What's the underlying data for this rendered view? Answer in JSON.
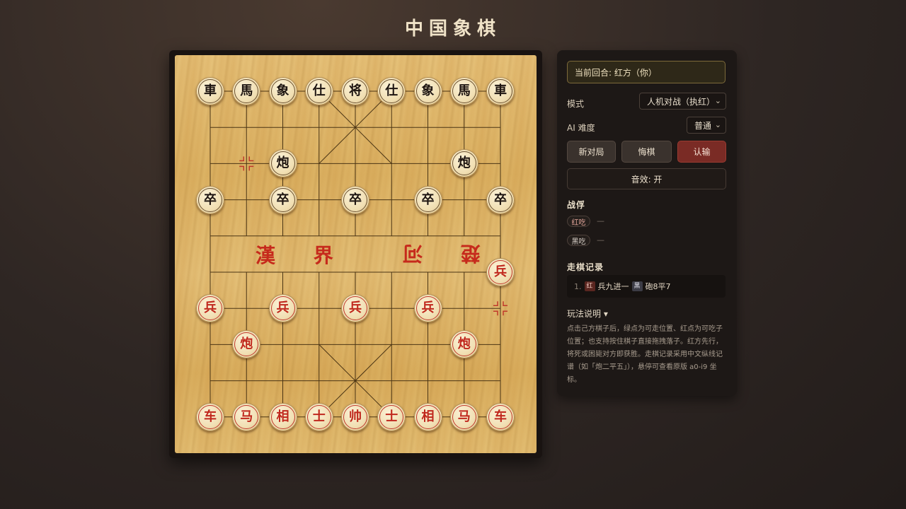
{
  "page_title": "中国象棋",
  "board": {
    "river_left": "漢 界",
    "river_right": "楚 河",
    "pieces": [
      {
        "c": "車",
        "side": "black",
        "f": 0,
        "r": 0
      },
      {
        "c": "馬",
        "side": "black",
        "f": 1,
        "r": 0
      },
      {
        "c": "象",
        "side": "black",
        "f": 2,
        "r": 0
      },
      {
        "c": "仕",
        "side": "black",
        "f": 3,
        "r": 0
      },
      {
        "c": "将",
        "side": "black",
        "f": 4,
        "r": 0
      },
      {
        "c": "仕",
        "side": "black",
        "f": 5,
        "r": 0
      },
      {
        "c": "象",
        "side": "black",
        "f": 6,
        "r": 0
      },
      {
        "c": "馬",
        "side": "black",
        "f": 7,
        "r": 0
      },
      {
        "c": "車",
        "side": "black",
        "f": 8,
        "r": 0
      },
      {
        "c": "炮",
        "side": "black",
        "f": 2,
        "r": 2
      },
      {
        "c": "炮",
        "side": "black",
        "f": 7,
        "r": 2
      },
      {
        "c": "卒",
        "side": "black",
        "f": 0,
        "r": 3
      },
      {
        "c": "卒",
        "side": "black",
        "f": 2,
        "r": 3
      },
      {
        "c": "卒",
        "side": "black",
        "f": 4,
        "r": 3
      },
      {
        "c": "卒",
        "side": "black",
        "f": 6,
        "r": 3
      },
      {
        "c": "卒",
        "side": "black",
        "f": 8,
        "r": 3
      },
      {
        "c": "兵",
        "side": "red",
        "f": 8,
        "r": 5
      },
      {
        "c": "兵",
        "side": "red",
        "f": 0,
        "r": 6
      },
      {
        "c": "兵",
        "side": "red",
        "f": 2,
        "r": 6
      },
      {
        "c": "兵",
        "side": "red",
        "f": 4,
        "r": 6
      },
      {
        "c": "兵",
        "side": "red",
        "f": 6,
        "r": 6
      },
      {
        "c": "炮",
        "side": "red",
        "f": 1,
        "r": 7
      },
      {
        "c": "炮",
        "side": "red",
        "f": 7,
        "r": 7
      },
      {
        "c": "车",
        "side": "red",
        "f": 0,
        "r": 9
      },
      {
        "c": "马",
        "side": "red",
        "f": 1,
        "r": 9
      },
      {
        "c": "相",
        "side": "red",
        "f": 2,
        "r": 9
      },
      {
        "c": "士",
        "side": "red",
        "f": 3,
        "r": 9
      },
      {
        "c": "帅",
        "side": "red",
        "f": 4,
        "r": 9
      },
      {
        "c": "士",
        "side": "red",
        "f": 5,
        "r": 9
      },
      {
        "c": "相",
        "side": "red",
        "f": 6,
        "r": 9
      },
      {
        "c": "马",
        "side": "red",
        "f": 7,
        "r": 9
      },
      {
        "c": "车",
        "side": "red",
        "f": 8,
        "r": 9
      }
    ],
    "last_move_markers": [
      {
        "f": 1,
        "r": 2,
        "color": "#c0392b"
      },
      {
        "f": 8,
        "r": 6,
        "color": "#c0392b"
      }
    ]
  },
  "panel": {
    "turn_text": "当前回合: 红方（你）",
    "mode_label": "模式",
    "mode_value": "人机对战（执红）",
    "difficulty_label": "AI 难度",
    "difficulty_value": "普通",
    "new_game": "新对局",
    "undo": "悔棋",
    "resign": "认输",
    "sound": "音效: 开",
    "captures_title": "战俘",
    "red_captured_label": "红吃",
    "red_captured_value": "—",
    "black_captured_label": "黑吃",
    "black_captured_value": "—",
    "record_title": "走棋记录",
    "record": {
      "index": "1.",
      "red_tag": "红",
      "red_move": "兵九进一",
      "black_tag": "黑",
      "black_move": "砲8平7"
    },
    "rules_title": "玩法说明 ▾",
    "rules_text": "点击己方棋子后，绿点为可走位置、红点为可吃子位置；也支持按住棋子直接拖拽落子。红方先行，将死或困毙对方即获胜。走棋记录采用中文纵线记谱（如「炮二平五」），悬停可查看原版 a0-i9 坐标。"
  },
  "colors": {
    "red_piece": "#c0281d",
    "black_piece": "#1d1410",
    "danger": "#7a2b25"
  }
}
